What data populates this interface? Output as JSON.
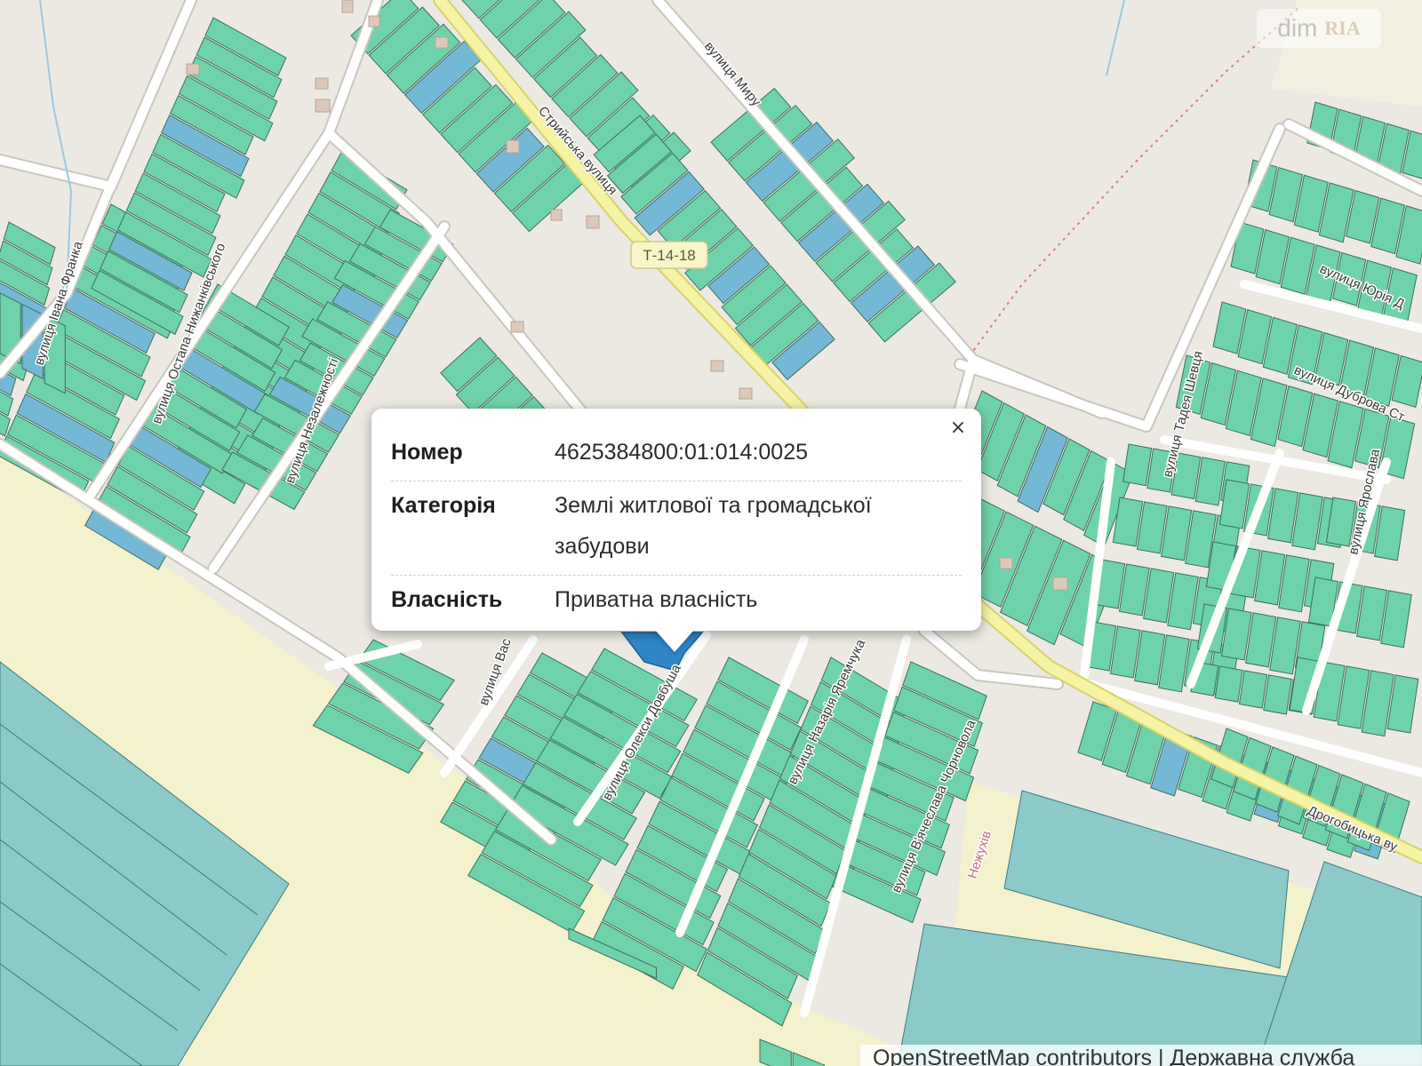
{
  "map": {
    "colors": {
      "background": "#ece9e3",
      "field": "#f4f1cd",
      "parcel_green": "#6ed3aa",
      "parcel_teal": "#8ccaca",
      "parcel_blue": "#74b8d6",
      "parcel_outline": "#3d6f5f",
      "road": "#ffffff",
      "main_road": "#f6f3a4",
      "main_road_casing": "#d7d26a",
      "selected_parcel": "#2e86c9"
    },
    "streets": [
      {
        "id": "franka",
        "label": "вулиця Івана Франка"
      },
      {
        "id": "nyzhankivskoho",
        "label": "вулиця Остапа Нижанківського"
      },
      {
        "id": "nezalezhnosti",
        "label": "вулиця Незалежності"
      },
      {
        "id": "stryiska",
        "label": "Стрийська вулиця"
      },
      {
        "id": "myru",
        "label": "вулиця Миру"
      },
      {
        "id": "vasylia",
        "label": "вулиця Вас"
      },
      {
        "id": "dovbusha",
        "label": "вулиця Олекси Довбуша"
      },
      {
        "id": "yaremchuka",
        "label": "вулиця Назарія Яремчука"
      },
      {
        "id": "chornovola",
        "label": "вулиця В'ячеслава Чорновола"
      },
      {
        "id": "shevtsia",
        "label": "вулиця Тадея Шевця"
      },
      {
        "id": "yuriia",
        "label": "вулиця Юрія Д"
      },
      {
        "id": "dubrova",
        "label": "вулиця Дуброва Ст"
      },
      {
        "id": "yaroslava",
        "label": "вулиця Ярослава"
      },
      {
        "id": "drohobytska",
        "label": "Дрогобицька ву"
      },
      {
        "id": "nezhukhiv",
        "label": "Нежухів"
      }
    ],
    "road_shield": "Т-14-18"
  },
  "popup": {
    "close_symbol": "×",
    "rows": [
      {
        "key": "Номер",
        "value": "4625384800:01:014:0025"
      },
      {
        "key": "Категорія",
        "value": "Землі житлової та громадської забудови"
      },
      {
        "key": "Власність",
        "value": "Приватна власність"
      }
    ]
  },
  "attribution": "OpenStreetMap contributors | Державна служба",
  "watermark": {
    "left": "dim",
    "right": "RIA"
  }
}
